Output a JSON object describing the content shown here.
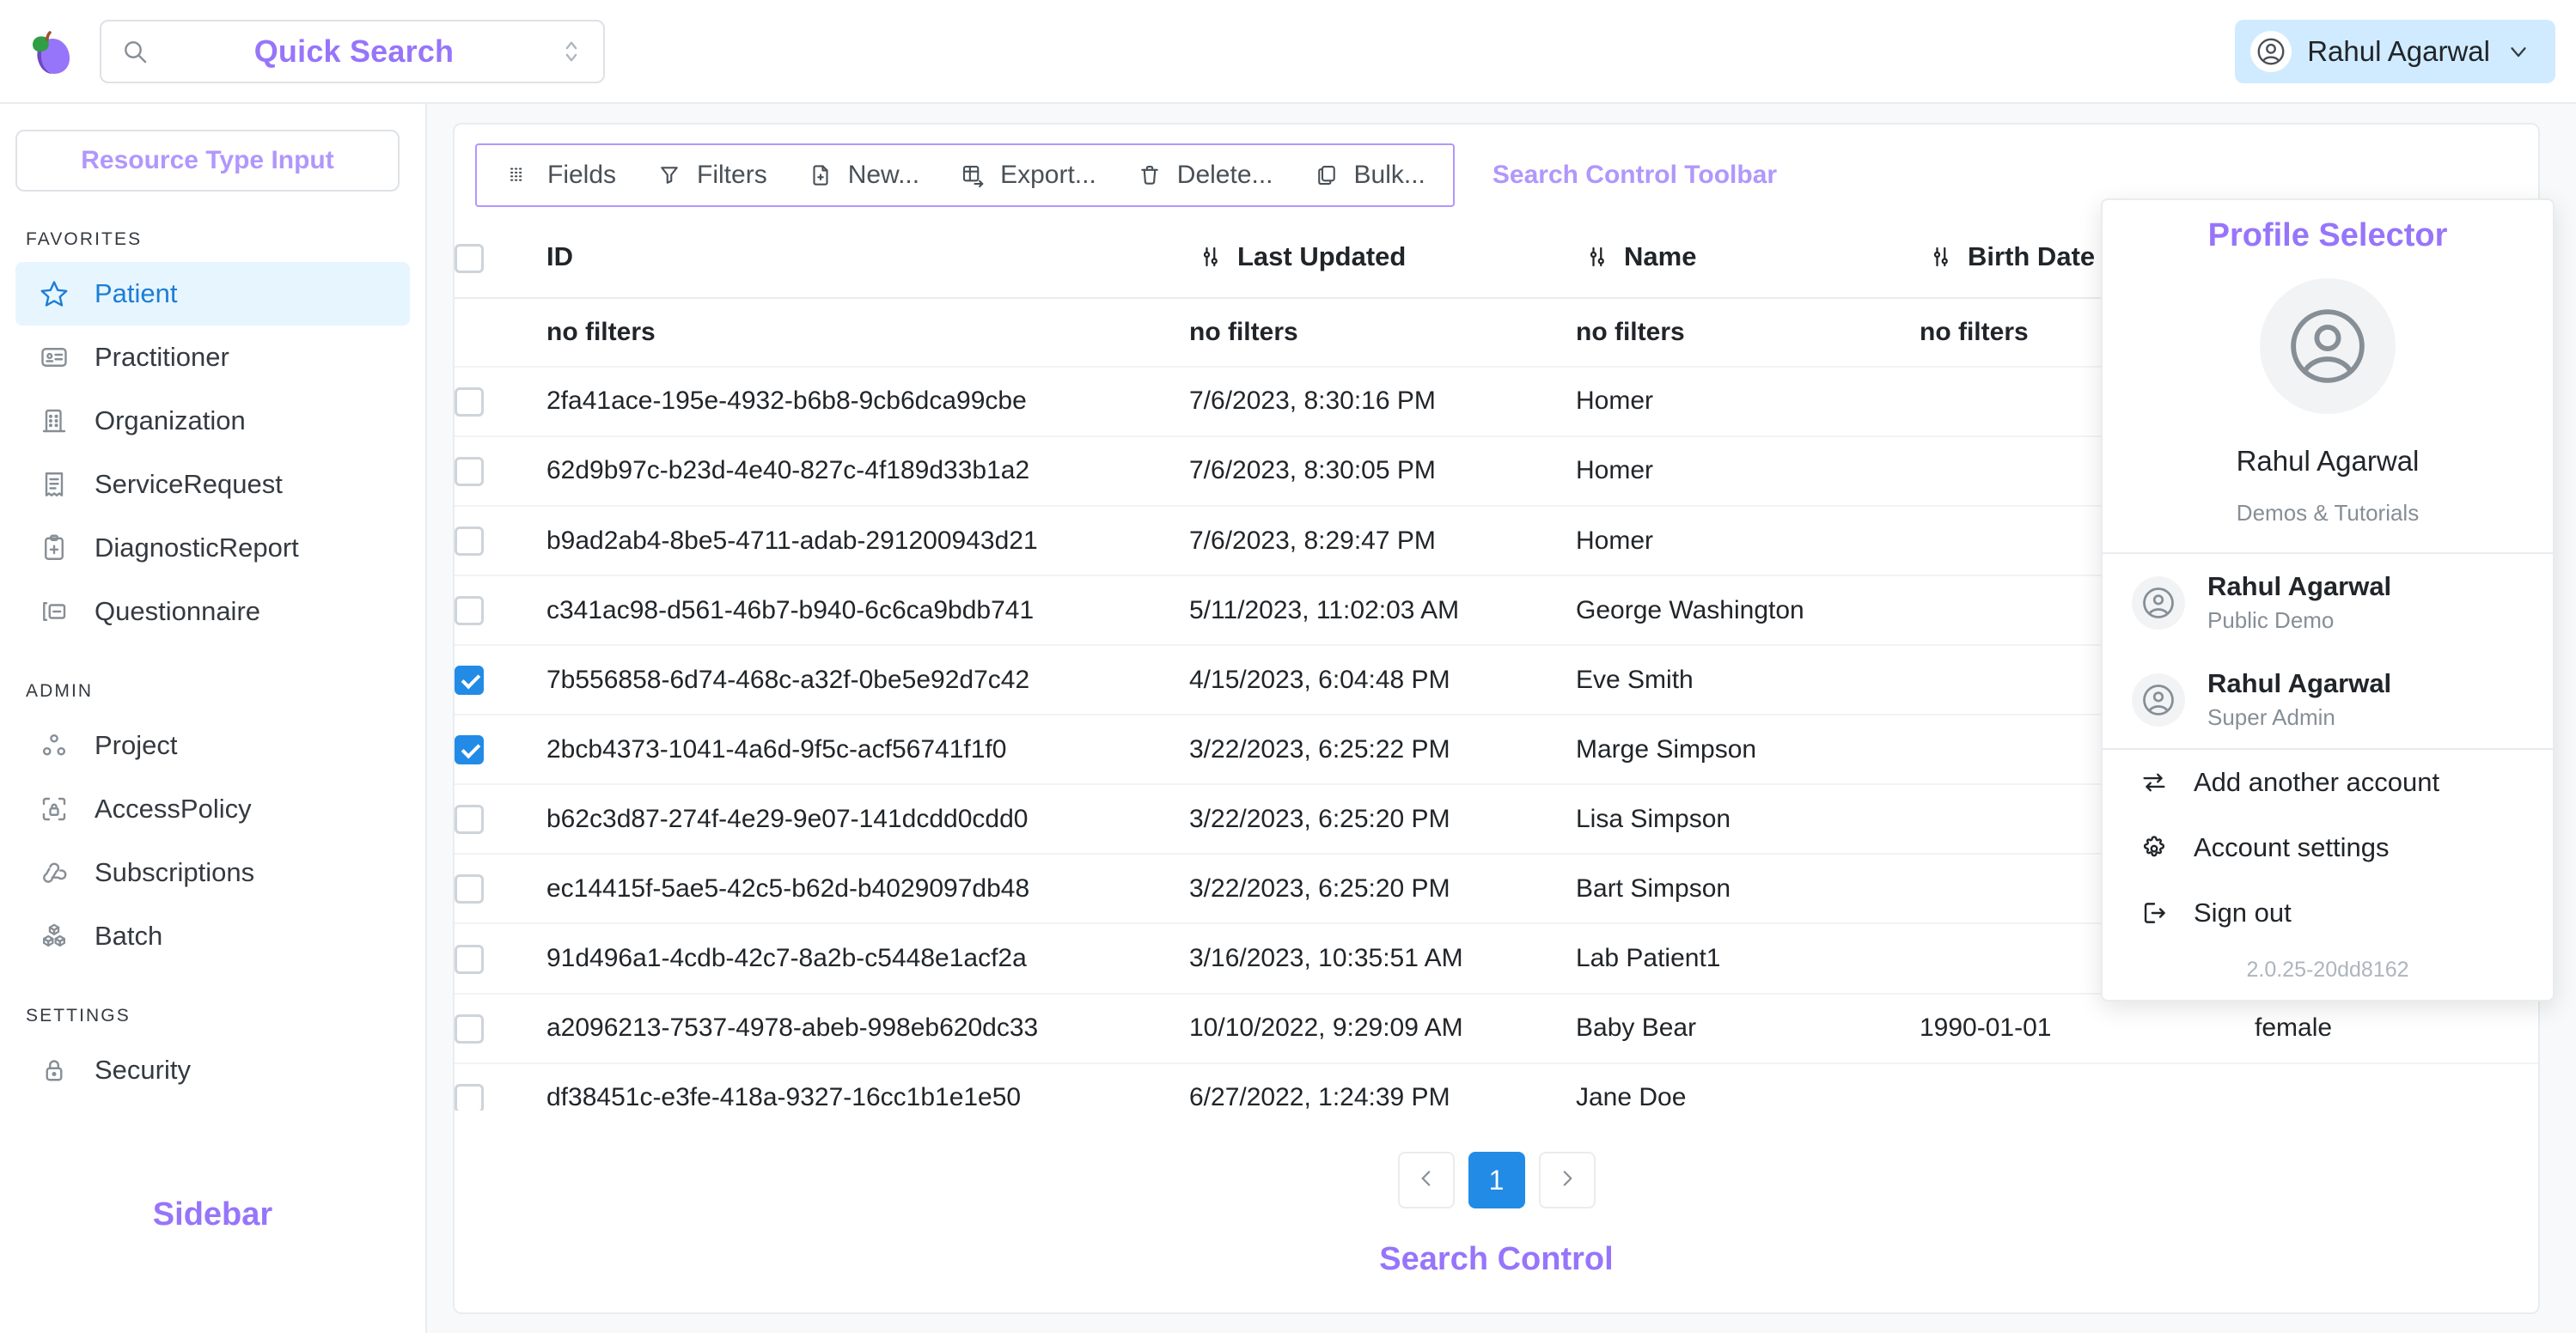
{
  "header": {
    "logo_icon": "plum-logo-icon",
    "quick_search": {
      "icon": "search-icon",
      "label": "Quick Search",
      "chevron_icon": "chevron-updown-icon"
    },
    "user_button": {
      "avatar_icon": "user-circle-icon",
      "name": "Rahul Agarwal",
      "chevron_icon": "chevron-down-icon"
    }
  },
  "sidebar": {
    "resource_type_input": "Resource Type Input",
    "annotation": "Sidebar",
    "sections": [
      {
        "title": "FAVORITES",
        "items": [
          {
            "label": "Patient",
            "icon": "star-icon",
            "active": true
          },
          {
            "label": "Practitioner",
            "icon": "id-badge-icon",
            "active": false
          },
          {
            "label": "Organization",
            "icon": "building-icon",
            "active": false
          },
          {
            "label": "ServiceRequest",
            "icon": "receipt-icon",
            "active": false
          },
          {
            "label": "DiagnosticReport",
            "icon": "clipboard-plus-icon",
            "active": false
          },
          {
            "label": "Questionnaire",
            "icon": "forms-icon",
            "active": false
          }
        ]
      },
      {
        "title": "ADMIN",
        "items": [
          {
            "label": "Project",
            "icon": "nodes-icon",
            "active": false
          },
          {
            "label": "AccessPolicy",
            "icon": "lock-access-icon",
            "active": false
          },
          {
            "label": "Subscriptions",
            "icon": "webhook-icon",
            "active": false
          },
          {
            "label": "Batch",
            "icon": "cubes-icon",
            "active": false
          }
        ]
      },
      {
        "title": "SETTINGS",
        "items": [
          {
            "label": "Security",
            "icon": "lock-icon",
            "active": false
          }
        ]
      }
    ]
  },
  "toolbar": {
    "annotation": "Search Control Toolbar",
    "buttons": [
      {
        "label": "Fields",
        "icon": "columns-icon"
      },
      {
        "label": "Filters",
        "icon": "funnel-icon"
      },
      {
        "label": "New...",
        "icon": "file-plus-icon"
      },
      {
        "label": "Export...",
        "icon": "table-export-icon"
      },
      {
        "label": "Delete...",
        "icon": "trash-icon"
      },
      {
        "label": "Bulk...",
        "icon": "copy-icon"
      }
    ]
  },
  "table": {
    "select_all_checked": false,
    "columns": [
      {
        "key": "checkbox",
        "label": "",
        "sort_icon": null
      },
      {
        "key": "id",
        "label": "ID",
        "sort_icon": "adjustments-icon"
      },
      {
        "key": "last_updated",
        "label": "Last Updated",
        "sort_icon": "adjustments-icon"
      },
      {
        "key": "name",
        "label": "Name",
        "sort_icon": "adjustments-icon"
      },
      {
        "key": "birth_date",
        "label": "Birth Date",
        "sort_icon": null
      },
      {
        "key": "gender",
        "label": "",
        "sort_icon": null
      }
    ],
    "filter_row": {
      "id": "no filters",
      "last_updated": "no filters",
      "name": "no filters",
      "birth_date": "no filters"
    },
    "rows": [
      {
        "checked": false,
        "id": "2fa41ace-195e-4932-b6b8-9cb6dca99cbe",
        "last_updated": "7/6/2023, 8:30:16 PM",
        "name": "Homer",
        "birth_date": "",
        "gender": ""
      },
      {
        "checked": false,
        "id": "62d9b97c-b23d-4e40-827c-4f189d33b1a2",
        "last_updated": "7/6/2023, 8:30:05 PM",
        "name": "Homer",
        "birth_date": "",
        "gender": ""
      },
      {
        "checked": false,
        "id": "b9ad2ab4-8be5-4711-adab-291200943d21",
        "last_updated": "7/6/2023, 8:29:47 PM",
        "name": "Homer",
        "birth_date": "",
        "gender": ""
      },
      {
        "checked": false,
        "id": "c341ac98-d561-46b7-b940-6c6ca9bdb741",
        "last_updated": "5/11/2023, 11:02:03 AM",
        "name": "George Washington",
        "birth_date": "",
        "gender": ""
      },
      {
        "checked": true,
        "id": "7b556858-6d74-468c-a32f-0be5e92d7c42",
        "last_updated": "4/15/2023, 6:04:48 PM",
        "name": "Eve Smith",
        "birth_date": "",
        "gender": ""
      },
      {
        "checked": true,
        "id": "2bcb4373-1041-4a6d-9f5c-acf56741f1f0",
        "last_updated": "3/22/2023, 6:25:22 PM",
        "name": "Marge Simpson",
        "birth_date": "",
        "gender": ""
      },
      {
        "checked": false,
        "id": "b62c3d87-274f-4e29-9e07-141dcdd0cdd0",
        "last_updated": "3/22/2023, 6:25:20 PM",
        "name": "Lisa Simpson",
        "birth_date": "",
        "gender": ""
      },
      {
        "checked": false,
        "id": "ec14415f-5ae5-42c5-b62d-b4029097db48",
        "last_updated": "3/22/2023, 6:25:20 PM",
        "name": "Bart Simpson",
        "birth_date": "",
        "gender": ""
      },
      {
        "checked": false,
        "id": "91d496a1-4cdb-42c7-8a2b-c5448e1acf2a",
        "last_updated": "3/16/2023, 10:35:51 AM",
        "name": "Lab Patient1",
        "birth_date": "",
        "gender": ""
      },
      {
        "checked": false,
        "id": "a2096213-7537-4978-abeb-998eb620dc33",
        "last_updated": "10/10/2022, 9:29:09 AM",
        "name": "Baby Bear",
        "birth_date": "1990-01-01",
        "gender": "female"
      },
      {
        "checked": false,
        "id": "df38451c-e3fe-418a-9327-16cc1b1e1e50",
        "last_updated": "6/27/2022, 1:24:39 PM",
        "name": "Jane Doe",
        "birth_date": "",
        "gender": ""
      }
    ]
  },
  "pagination": {
    "prev_icon": "chevron-left-icon",
    "next_icon": "chevron-right-icon",
    "current_page": "1"
  },
  "search_control_annotation": "Search Control",
  "profile_selector": {
    "title": "Profile Selector",
    "avatar_icon": "user-circle-large-icon",
    "name": "Rahul Agarwal",
    "project": "Demos & Tutorials",
    "accounts": [
      {
        "name": "Rahul Agarwal",
        "role": "Public Demo",
        "icon": "user-circle-icon"
      },
      {
        "name": "Rahul Agarwal",
        "role": "Super Admin",
        "icon": "user-circle-icon"
      }
    ],
    "menu": [
      {
        "label": "Add another account",
        "icon": "switch-account-icon"
      },
      {
        "label": "Account settings",
        "icon": "gear-icon"
      },
      {
        "label": "Sign out",
        "icon": "logout-icon"
      }
    ],
    "version": "2.0.25-20dd8162"
  },
  "colors": {
    "accent_purple": "#9775fa",
    "accent_purple_light": "#b197fc",
    "blue": "#228be6",
    "blue_light": "#d0ebff",
    "active_nav_bg": "#e7f5ff",
    "active_nav_text": "#1c7ed6"
  }
}
